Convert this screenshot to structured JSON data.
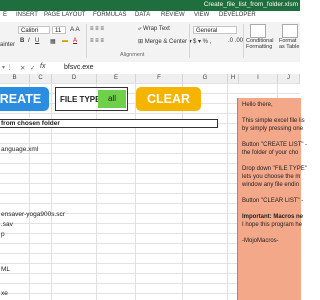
{
  "window": {
    "title": "Create_file_list_from_folder.xlsm"
  },
  "menu": {
    "tabs": [
      "E",
      "INSERT",
      "PAGE LAYOUT",
      "FORMULAS",
      "DATA",
      "REVIEW",
      "VIEW",
      "DEVELOPER"
    ]
  },
  "ribbon": {
    "left_label": "ainter",
    "font_name": "Calibri",
    "font_size": "11",
    "wrap_text": "Wrap Text",
    "merge_center": "Merge & Center",
    "number_format": "General",
    "alignment_group": "Alignment",
    "conditional_formatting": "Conditional Formatting",
    "format_as_table": "Format as Table"
  },
  "formula_bar": {
    "fx": "fx",
    "content": "bfsvc.exe"
  },
  "columns": [
    "B",
    "C",
    "D",
    "E",
    "F",
    "G",
    "H",
    "I",
    "J"
  ],
  "buttons": {
    "create_list": "REATE LIST",
    "file_type_label": "FILE TYPE",
    "file_type_value": "all",
    "clear_list": "CLEAR LIST"
  },
  "header_row": "from chosen folder",
  "file_cells": [
    {
      "row": 5,
      "text": "anguage.xml"
    },
    {
      "row": 11,
      "text": "ensaver-yoga900s.scr"
    },
    {
      "row": 12,
      "text": ".sav"
    },
    {
      "row": 13,
      "text": "p"
    },
    {
      "row": 17,
      "text": "ML"
    },
    {
      "row": 20,
      "text": "xe"
    }
  ],
  "note": {
    "lines": [
      "Hello there,",
      "",
      "This simple excel file lis",
      "by simply pressing one",
      "",
      "Button \"CREATE LIST\" -",
      "the folder of your cho",
      "",
      "Drop down \"FILE TYPE\"",
      "lets you choose the m",
      "window any file endin",
      "",
      "Button \"CLEAR LIST\" -",
      "",
      "Important: Macros ne",
      "I hope this program he",
      "",
      "-MojoMacros-"
    ]
  },
  "colors": {
    "excel_green": "#1e6e3e",
    "create_button": "#2b8ddf",
    "clear_button": "#f4b400",
    "all_cell": "#6fd04a",
    "note_bg": "#f4a88a"
  }
}
